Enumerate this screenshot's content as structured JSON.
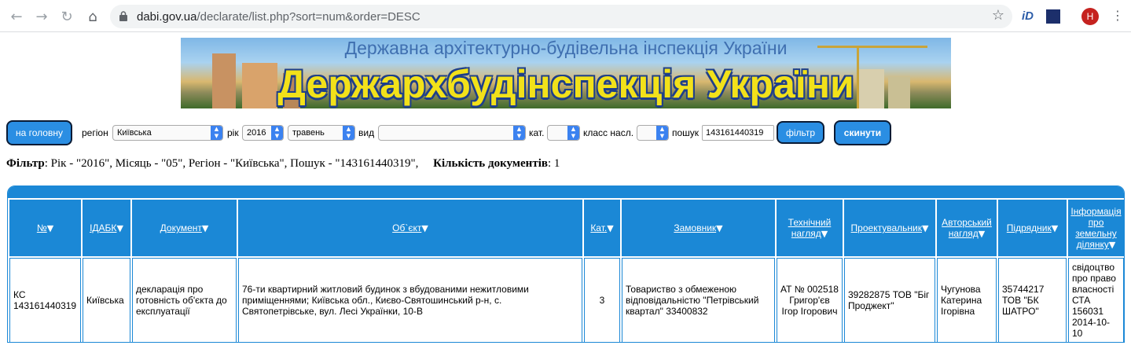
{
  "browser": {
    "url_host": "dabi.gov.ua",
    "url_path": "/declarate/list.php?sort=num&order=DESC",
    "profile_initial": "H",
    "ext_label": "iD"
  },
  "banner": {
    "top_text": "Державна архітектурно-будівельна інспекція України",
    "main_text": "Держархбудінспекція України"
  },
  "filters": {
    "home_button": "на головну",
    "region_label": "регіон",
    "region_value": "Київська",
    "year_label": "рік",
    "year_value": "2016",
    "month_value": "травень",
    "type_label": "вид",
    "type_value": "",
    "cat_label": "кат.",
    "cat_value": "",
    "class_label": "класс насл.",
    "class_value": "",
    "search_label": "пошук",
    "search_value": "143161440319",
    "filter_button": "фільтр",
    "reset_button": "скинути"
  },
  "summary": {
    "filter_word": "Фільтр",
    "filter_text": ": Рік - \"2016\", Місяць - \"05\", Регіон - \"Київська\", Пошук - \"143161440319\",",
    "count_label": "Кількість документів",
    "count_value": ": 1"
  },
  "table": {
    "headers": [
      "№",
      "ІДАБК",
      "Документ",
      "Об`єкт",
      "Кат.",
      "Замовник",
      "Технічний нагляд",
      "Проектувальник",
      "Авторський нагляд",
      "Підрядник",
      "Інформація про земельну ділянку"
    ],
    "row": {
      "num": "КС 143161440319",
      "idabk": "Київська",
      "document": "декларація про готовність об'єкта до експлуатації",
      "object": "76-ти квартирний житловий будинок з вбудованими нежитловими приміщеннями; Київська обл., Києво-Святошинський р-н, с. Святопетрівське, вул. Лесі Українки, 10-В",
      "category": "3",
      "customer": "Товариство з обмеженою відповідальністю \"Петрівський квартал\" 33400832",
      "tech_supervision": "АТ № 002518 Григор'єв Ігор Ігорович",
      "designer": "39282875 ТОВ \"Біг Проджект\"",
      "author_supervision": "Чугунова Катерина Ігорівна",
      "contractor": "35744217 ТОВ \"БК ШАТРО\"",
      "land_info": "свідоцтво про право власності СТА 156031 2014-10-10"
    }
  }
}
